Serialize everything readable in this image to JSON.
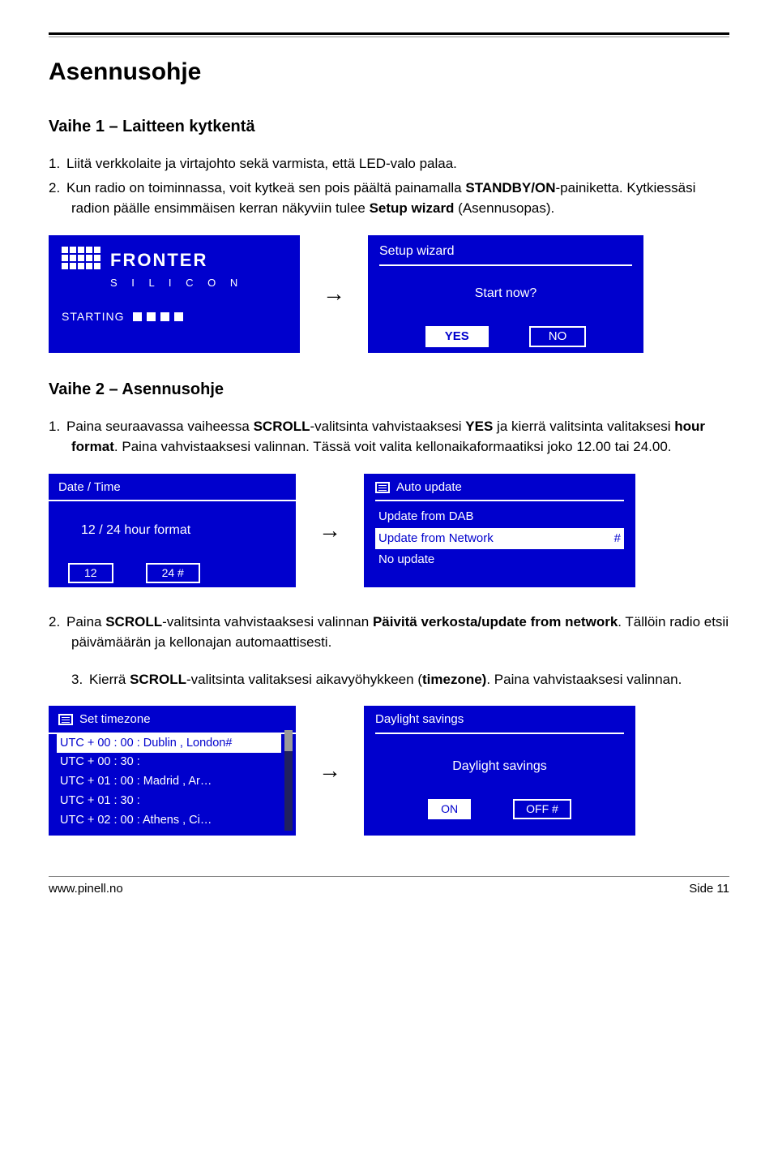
{
  "page_title": "Asennusohje",
  "step1": {
    "heading": "Vaihe 1 – Laitteen kytkentä",
    "li1_num": "1.",
    "li1_text": "Liitä verkkolaite ja virtajohto sekä varmista, että LED-valo palaa.",
    "li2_num": "2.",
    "li2_a": "Kun radio on toiminnassa, voit kytkeä sen pois päältä painamalla ",
    "li2_b": "STANDBY/ON",
    "li2_c": "-painiketta. Kytkiessäsi radion päälle ensimmäisen kerran näkyviin tulee ",
    "li2_d": "Setup wizard",
    "li2_e": " (Asennusopas)."
  },
  "screen_boot": {
    "brand_top": "FRONTER",
    "brand_bottom": "S I L I C O N",
    "starting": "STARTING"
  },
  "screen_wizard": {
    "title": "Setup  wizard",
    "prompt": "Start  now?",
    "yes": "YES",
    "no": "NO"
  },
  "step2": {
    "heading": "Vaihe 2 – Asennusohje",
    "li1_num": "1.",
    "li1_a": "Paina seuraavassa vaiheessa ",
    "li1_b": "SCROLL",
    "li1_c": "-valitsinta vahvistaaksesi ",
    "li1_d": "YES",
    "li1_e": " ja kierrä valitsinta valitaksesi ",
    "li1_f": "hour format",
    "li1_g": ". Paina vahvistaaksesi valinnan. Tässä voit valita kellonaikaformaatiksi joko 12.00 tai 24.00."
  },
  "screen_datetime": {
    "title": "Date / Time",
    "mid": "12 / 24  hour  format",
    "opt12": "12",
    "opt24": "24  #"
  },
  "screen_update": {
    "title": "Auto  update",
    "r1": "Update  from  DAB",
    "r2": "Update  from  Network",
    "r2_hash": "#",
    "r3": "No  update"
  },
  "tail": {
    "li2_num": "2.",
    "li2_a": "Paina ",
    "li2_b": "SCROLL",
    "li2_c": "-valitsinta vahvistaaksesi valinnan ",
    "li2_d": "Päivitä verkosta/update from network",
    "li2_e": ". Tällöin radio etsii päivämäärän ja kellonajan automaattisesti.",
    "li3_num": "3.",
    "li3_a": "Kierrä ",
    "li3_b": "SCROLL",
    "li3_c": "-valitsinta valitaksesi aikavyöhykkeen (",
    "li3_d": "timezone)",
    "li3_e": ". Paina vahvistaaksesi valinnan."
  },
  "screen_tz": {
    "title": "Set  timezone",
    "rows": [
      "UTC  + 00 : 00 :  Dublin , London#",
      "UTC  + 00 : 30 :",
      "UTC  + 01 : 00 : Madrid ,  Ar…",
      "UTC  + 01 : 30 :",
      "UTC  + 02 : 00 :  Athens , Ci…"
    ]
  },
  "screen_daylight": {
    "title": "Daylight  savings",
    "mid": "Daylight  savings",
    "on": "ON",
    "off": "OFF  #"
  },
  "footer": {
    "url": "www.pinell.no",
    "side": "Side 11"
  }
}
